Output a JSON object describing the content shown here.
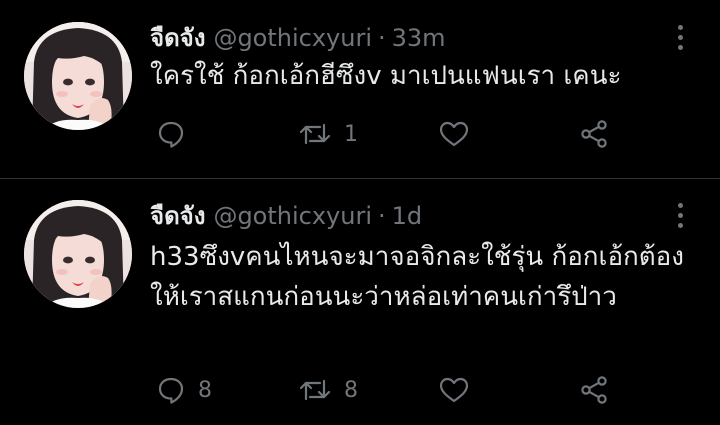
{
  "tweets": [
    {
      "display_name": "จืดจัง",
      "handle": "@gothicxyuri",
      "separator": "·",
      "time": "33m",
      "text": "ใครใช้ ก้อกเอ้กฮีซึงv มาเปนแฟนเรา เคนะ",
      "replies": "",
      "retweets": "1",
      "likes": ""
    },
    {
      "display_name": "จืดจัง",
      "handle": "@gothicxyuri",
      "separator": "·",
      "time": "1d",
      "text": "h33ซึงvคนไหนจะมาจอจิกละใช้รุ่น ก้อกเอ้กต้องให้เราสแกนก่อนนะว่าหล่อเท่าคนเก่ารึป่าว",
      "replies": "8",
      "retweets": "8",
      "likes": ""
    }
  ],
  "icons": {
    "reply": "speech-bubble-icon",
    "retweet": "retweet-arrows-icon",
    "like": "heart-outline-icon",
    "share": "share-nodes-icon",
    "more": "vertical-ellipsis-icon"
  },
  "colors": {
    "background": "#000000",
    "primary_text": "#e7e9ea",
    "secondary_text": "#71767b",
    "divider": "#2f3336"
  }
}
